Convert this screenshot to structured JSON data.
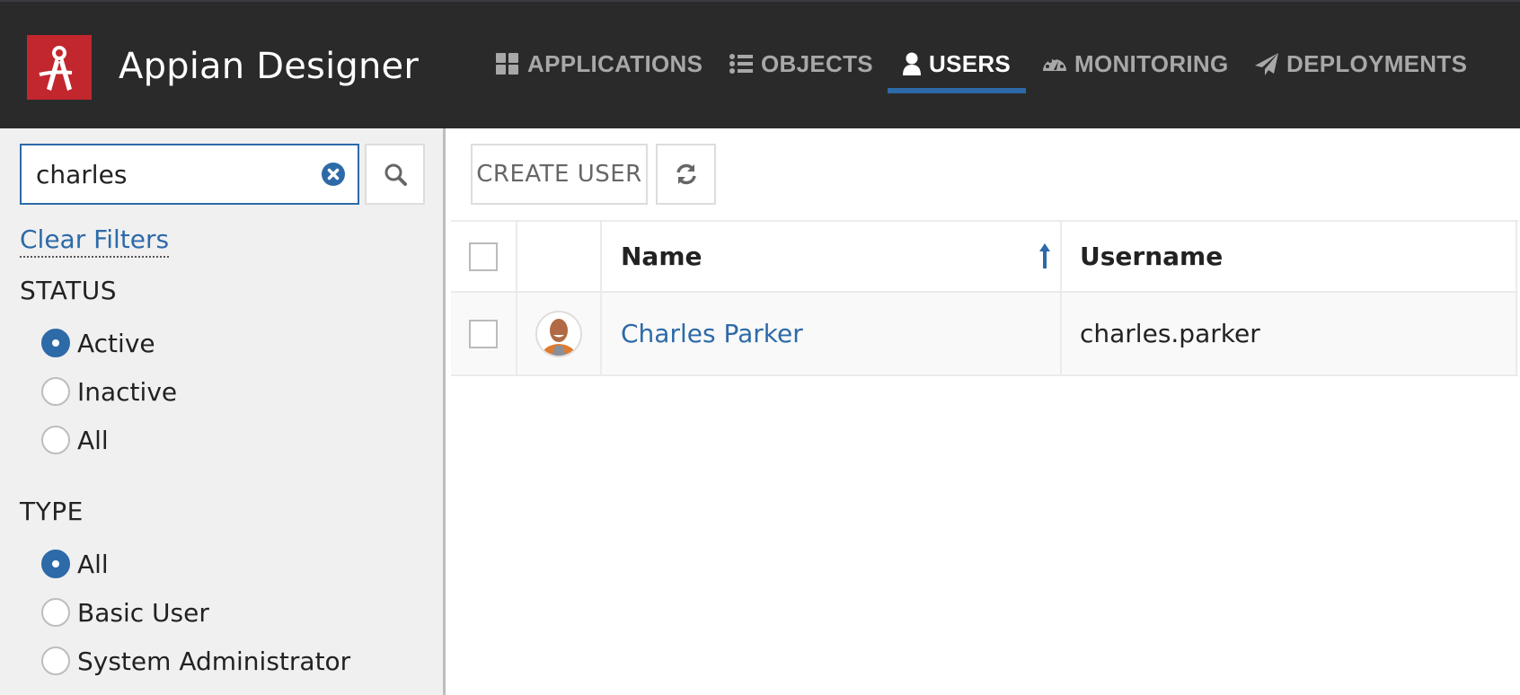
{
  "header": {
    "app_title": "Appian Designer",
    "brand_color": "#c1272d",
    "accent_color": "#2d6aa8",
    "nav": [
      {
        "label": "APPLICATIONS",
        "icon": "grid-icon",
        "active": false
      },
      {
        "label": "OBJECTS",
        "icon": "list-icon",
        "active": false
      },
      {
        "label": "USERS",
        "icon": "user-icon",
        "active": true
      },
      {
        "label": "MONITORING",
        "icon": "dashboard-icon",
        "active": false
      },
      {
        "label": "DEPLOYMENTS",
        "icon": "paper-plane-icon",
        "active": false
      }
    ]
  },
  "sidebar": {
    "search": {
      "value": "charles",
      "placeholder": ""
    },
    "clear_filters_label": "Clear Filters",
    "status": {
      "title": "STATUS",
      "options": [
        {
          "label": "Active",
          "checked": true
        },
        {
          "label": "Inactive",
          "checked": false
        },
        {
          "label": "All",
          "checked": false
        }
      ]
    },
    "type": {
      "title": "TYPE",
      "options": [
        {
          "label": "All",
          "checked": true
        },
        {
          "label": "Basic User",
          "checked": false
        },
        {
          "label": "System Administrator",
          "checked": false
        }
      ]
    }
  },
  "main": {
    "create_user_label": "CREATE USER",
    "refresh_icon": "refresh-icon",
    "table": {
      "columns": [
        {
          "key": "select",
          "label": ""
        },
        {
          "key": "avatar",
          "label": ""
        },
        {
          "key": "name",
          "label": "Name",
          "sort": "ascending"
        },
        {
          "key": "username",
          "label": "Username"
        }
      ],
      "rows": [
        {
          "name": "Charles Parker",
          "username": "charles.parker",
          "selected": false
        }
      ]
    }
  }
}
